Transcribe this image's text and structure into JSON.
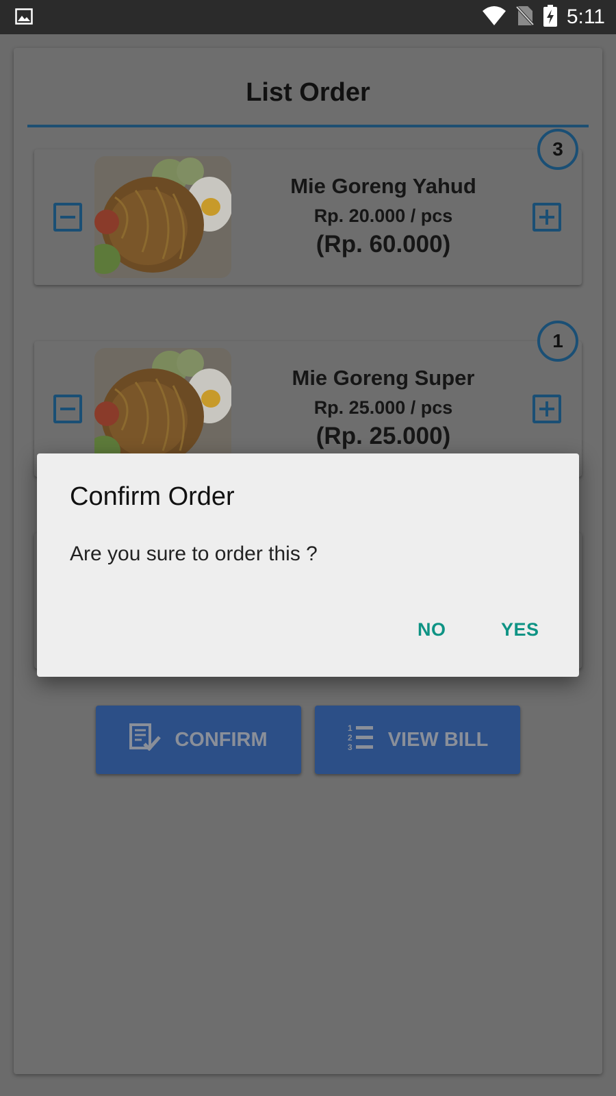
{
  "status_bar": {
    "time": "5:11",
    "icons": [
      "image-icon",
      "wifi-icon",
      "no-sim-icon",
      "battery-charging-icon"
    ]
  },
  "page": {
    "title": "List Order"
  },
  "orders": [
    {
      "name": "Mie Goreng Yahud",
      "unit_price": "Rp. 20.000 / pcs",
      "total": "(Rp. 60.000)",
      "quantity": "3"
    },
    {
      "name": "Mie Goreng Super",
      "unit_price": "Rp. 25.000 / pcs",
      "total": "(Rp. 25.000)",
      "quantity": "1"
    }
  ],
  "actions": {
    "confirm_label": "CONFIRM",
    "confirm_icon": "checklist-icon",
    "view_bill_label": "VIEW BILL",
    "view_bill_icon": "numbered-list-icon"
  },
  "dialog": {
    "title": "Confirm Order",
    "message": "Are you sure to order this ?",
    "no_label": "NO",
    "yes_label": "YES"
  },
  "colors": {
    "accent": "#1a4f75",
    "button_bg": "#2c4f87",
    "dialog_button": "#0e9384",
    "status_bar": "#2b2b2b"
  }
}
